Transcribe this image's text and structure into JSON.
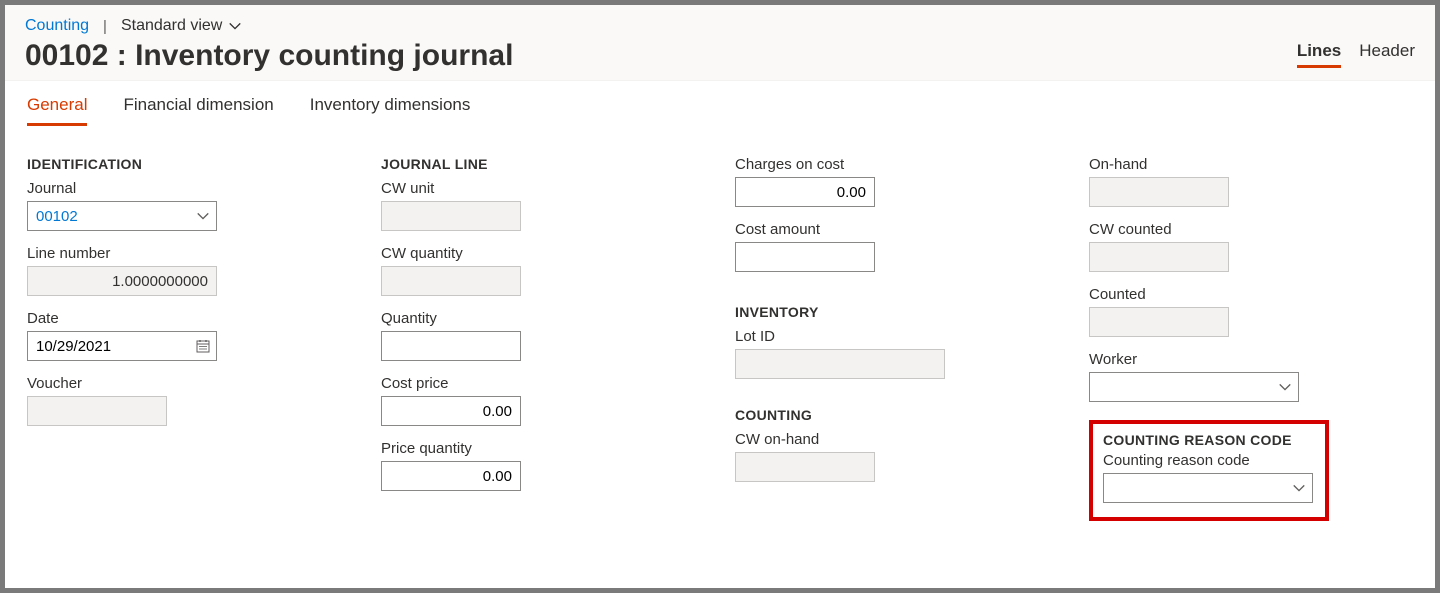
{
  "breadcrumb": {
    "link": "Counting",
    "view_label": "Standard view"
  },
  "page_title": "00102 : Inventory counting journal",
  "view_tabs": {
    "lines": "Lines",
    "header": "Header"
  },
  "section_tabs": {
    "general": "General",
    "financial": "Financial dimension",
    "inventory": "Inventory dimensions"
  },
  "identification": {
    "heading": "IDENTIFICATION",
    "journal": {
      "label": "Journal",
      "value": "00102"
    },
    "line_number": {
      "label": "Line number",
      "value": "1.0000000000"
    },
    "date": {
      "label": "Date",
      "value": "10/29/2021"
    },
    "voucher": {
      "label": "Voucher",
      "value": ""
    }
  },
  "journal_line": {
    "heading": "JOURNAL LINE",
    "cw_unit": {
      "label": "CW unit",
      "value": ""
    },
    "cw_quantity": {
      "label": "CW quantity",
      "value": ""
    },
    "quantity": {
      "label": "Quantity",
      "value": ""
    },
    "cost_price": {
      "label": "Cost price",
      "value": "0.00"
    },
    "price_quantity": {
      "label": "Price quantity",
      "value": "0.00"
    },
    "charges_on_cost": {
      "label": "Charges on cost",
      "value": "0.00"
    },
    "cost_amount": {
      "label": "Cost amount",
      "value": ""
    }
  },
  "inventory": {
    "heading": "INVENTORY",
    "lot_id": {
      "label": "Lot ID",
      "value": ""
    }
  },
  "counting": {
    "heading": "COUNTING",
    "cw_on_hand": {
      "label": "CW on-hand",
      "value": ""
    },
    "on_hand": {
      "label": "On-hand",
      "value": ""
    },
    "cw_counted": {
      "label": "CW counted",
      "value": ""
    },
    "counted": {
      "label": "Counted",
      "value": ""
    },
    "worker": {
      "label": "Worker",
      "value": ""
    }
  },
  "counting_reason": {
    "heading": "COUNTING REASON CODE",
    "code": {
      "label": "Counting reason code",
      "value": ""
    }
  }
}
